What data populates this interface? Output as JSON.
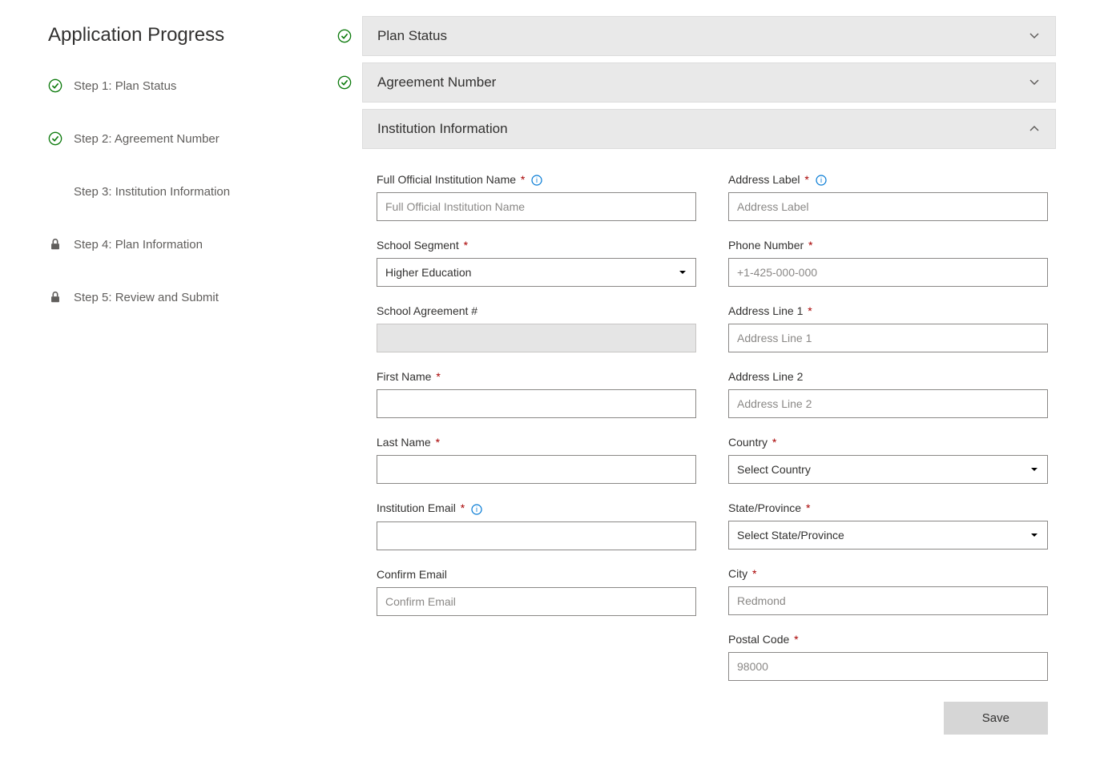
{
  "sidebar": {
    "title": "Application Progress",
    "steps": [
      {
        "label": "Step 1: Plan Status",
        "icon": "check"
      },
      {
        "label": "Step 2: Agreement Number",
        "icon": "check"
      },
      {
        "label": "Step 3: Institution Information",
        "icon": "none"
      },
      {
        "label": "Step 4: Plan Information",
        "icon": "lock"
      },
      {
        "label": "Step 5: Review and Submit",
        "icon": "lock"
      }
    ]
  },
  "panels": {
    "plan_status": {
      "title": "Plan Status"
    },
    "agreement_number": {
      "title": "Agreement Number"
    },
    "institution_information": {
      "title": "Institution Information"
    }
  },
  "form": {
    "left": {
      "institution_name": {
        "label": "Full Official Institution Name",
        "placeholder": "Full Official Institution Name"
      },
      "school_segment": {
        "label": "School Segment",
        "value": "Higher Education"
      },
      "school_agreement": {
        "label": "School Agreement #"
      },
      "first_name": {
        "label": "First Name"
      },
      "last_name": {
        "label": "Last Name"
      },
      "institution_email": {
        "label": "Institution Email"
      },
      "confirm_email": {
        "label": "Confirm Email",
        "placeholder": "Confirm Email"
      }
    },
    "right": {
      "address_label": {
        "label": "Address Label",
        "placeholder": "Address Label"
      },
      "phone_number": {
        "label": "Phone Number",
        "placeholder": "+1-425-000-000"
      },
      "address_line_1": {
        "label": "Address Line 1",
        "placeholder": "Address Line 1"
      },
      "address_line_2": {
        "label": "Address Line 2",
        "placeholder": "Address Line 2"
      },
      "country": {
        "label": "Country",
        "value": "Select Country"
      },
      "state_province": {
        "label": "State/Province",
        "value": "Select State/Province"
      },
      "city": {
        "label": "City",
        "placeholder": "Redmond"
      },
      "postal_code": {
        "label": "Postal Code",
        "placeholder": "98000"
      }
    }
  },
  "buttons": {
    "save": "Save"
  }
}
